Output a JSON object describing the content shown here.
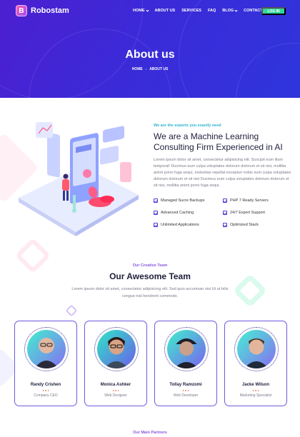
{
  "brand": {
    "name": "Robostam",
    "mark": "B"
  },
  "nav": {
    "items": [
      {
        "label": "HOME",
        "dropdown": true
      },
      {
        "label": "ABOUT US",
        "dropdown": false
      },
      {
        "label": "SERVICES",
        "dropdown": false
      },
      {
        "label": "FAQ",
        "dropdown": false
      },
      {
        "label": "BLOG",
        "dropdown": true
      },
      {
        "label": "CONTACT",
        "dropdown": false
      }
    ],
    "login_label": "LOG IN"
  },
  "hero": {
    "title": "About us",
    "breadcrumb": [
      "HOME",
      "ABOUT US"
    ]
  },
  "about": {
    "tagline": "We are the experts you exactly need",
    "heading": "We are a Machine Learning Consulting Firm Experienced in AI",
    "body": "Lorem ipsum dolor sit amet, consectetur adipisicing elit. Suscipit eum illum temporal! Ducimus eum culpa voluptates dolorum dolorum et sit nisi, mollitia animi porro fuga sequi, molestias repellat excepturi nobis eum culpa voluptates dolorum dolorum et sit nisi Ducimus eum culpa voluptates dolorum dolorum et sit nisi, mollitia animi porro fuga sequi.",
    "features": [
      "Managed Sucre Backups",
      "PHP 7 Ready Servers",
      "Advanced Caching",
      "24/7 Expert Support",
      "Unlimited Applications",
      "Optimized Stack"
    ]
  },
  "team": {
    "kicker": "Our Creative Team",
    "heading": "Our Awesome Team",
    "body": "Lorem ipsum dolor sit amet, consectetur adipisicing elit. Sed quio accumsan nisi Ut ut felis congue nisl hendrerit commodo.",
    "members": [
      {
        "name": "Randy Crishen",
        "role": "Company CEO"
      },
      {
        "name": "Monica Ashker",
        "role": "Web Designer"
      },
      {
        "name": "Tollay Ramzomi",
        "role": "Web Developer"
      },
      {
        "name": "Jacke Wilson",
        "role": "Marketing Specialist"
      }
    ]
  },
  "partners": {
    "kicker": "Our Main Partners"
  },
  "colors": {
    "hero_start": "#4c1fd0",
    "hero_end": "#2f35dc",
    "accent_green": "#32d59b",
    "accent_cyan": "#2ab4d0",
    "accent_purple": "#8a57e0",
    "card_border": "#6d5ae0"
  }
}
